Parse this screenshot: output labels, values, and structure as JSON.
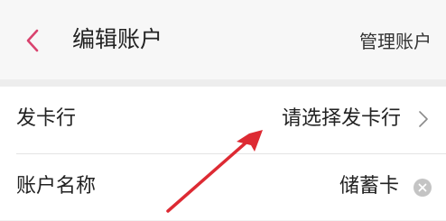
{
  "header": {
    "back_icon": "chevron-left-icon",
    "title": "编辑账户",
    "manage_label": "管理账户"
  },
  "form": {
    "bank": {
      "label": "发卡行",
      "value": "请选择发卡行",
      "icon": "chevron-right-icon"
    },
    "account_name": {
      "label": "账户名称",
      "value": "储蓄卡",
      "icon": "clear-icon"
    }
  },
  "colors": {
    "accent": "#d9436e",
    "annotation_arrow": "#dd2a33",
    "background": "#f2f2f2"
  }
}
